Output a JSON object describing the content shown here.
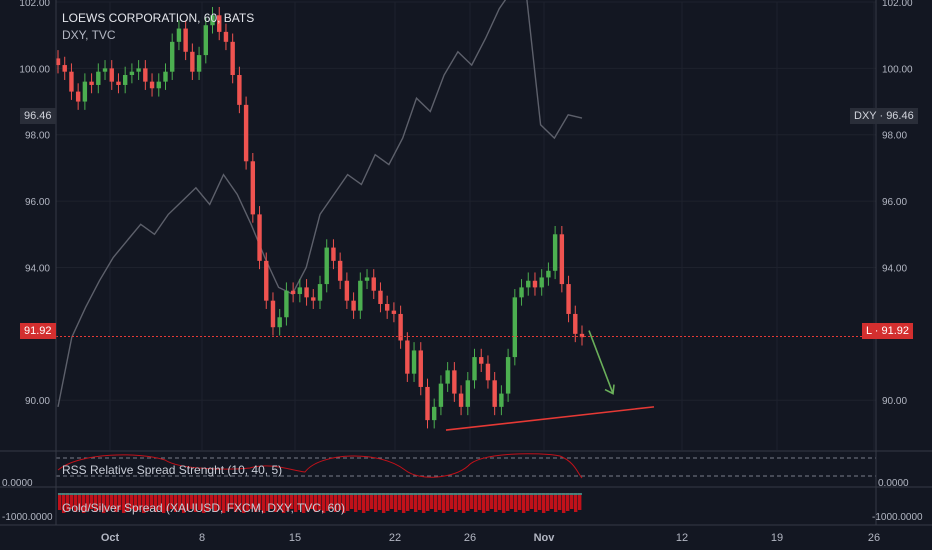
{
  "header": {
    "symbol_line": "LOEWS CORPORATION, 60, BATS",
    "overlay_line": "DXY, TVC"
  },
  "price_scale": {
    "ticks": [
      "102.00",
      "100.00",
      "98.00",
      "96.00",
      "94.00",
      "90.00"
    ],
    "current_price_label": "91.92",
    "right_current_label": "L · 91.92",
    "dxy_left_label": "96.46",
    "dxy_right_label": "DXY · 96.46"
  },
  "indicators": {
    "rss": {
      "label": "RSS Relative Spread Strenght (10, 40, 5)",
      "scale_label": "0.0000"
    },
    "gold_silver": {
      "label": "Gold/Silver Spread (XAUUSD, FXCM, DXY, TVC, 60)",
      "scale_label": "0.0000",
      "scale_label_low": "-1000.0000",
      "bar_color": "#c0111a"
    }
  },
  "time_axis": {
    "labels": [
      "Oct",
      "8",
      "15",
      "22",
      "26",
      "Nov",
      "12",
      "19",
      "26"
    ]
  },
  "colors": {
    "up_candle": "#4caf50",
    "down_candle": "#ef5350",
    "dxy_line": "#5d606b",
    "price_line": "#e53935",
    "support_line": "#e53935",
    "arrow": "#6aaf5a"
  },
  "chart_data": {
    "type": "candlestick",
    "series": [
      {
        "name": "LOEWS CORPORATION, 60, BATS",
        "ohlc_close": [
          100.1,
          99.9,
          99.3,
          99.0,
          99.6,
          99.5,
          99.9,
          100.0,
          99.6,
          99.5,
          99.8,
          99.9,
          100.0,
          99.6,
          99.4,
          99.6,
          99.9,
          100.8,
          101.2,
          100.5,
          99.9,
          100.4,
          101.3,
          101.6,
          101.1,
          100.8,
          99.8,
          98.9,
          97.2,
          95.6,
          94.2,
          93.0,
          92.2,
          92.5,
          93.3,
          93.2,
          93.4,
          93.1,
          93.0,
          93.5,
          94.6,
          94.2,
          93.6,
          93.0,
          92.7,
          93.6,
          93.7,
          93.3,
          92.9,
          92.7,
          92.6,
          91.8,
          90.8,
          91.5,
          90.4,
          89.4,
          89.8,
          90.5,
          90.9,
          90.2,
          89.8,
          90.6,
          91.3,
          91.1,
          90.6,
          89.8,
          90.2,
          91.3,
          93.1,
          93.4,
          93.6,
          93.4,
          93.7,
          93.9,
          95.0,
          93.5,
          92.6,
          92.0,
          91.9
        ],
        "range": [
          "Oct 1",
          "Nov 5"
        ]
      },
      {
        "name": "DXY, TVC",
        "values": [
          89.8,
          91.9,
          92.8,
          93.6,
          94.3,
          94.8,
          95.3,
          95.0,
          95.6,
          96.0,
          96.4,
          95.9,
          96.8,
          96.2,
          95.3,
          94.3,
          93.4,
          93.2,
          94.0,
          95.6,
          96.2,
          96.8,
          96.5,
          97.4,
          97.1,
          97.9,
          99.1,
          98.7,
          99.8,
          100.5,
          100.1,
          100.9,
          101.8,
          102.4,
          102.1,
          98.3,
          97.9,
          98.6,
          98.5
        ],
        "range": [
          "Oct 1",
          "Nov 4"
        ]
      }
    ],
    "current_price": 91.92,
    "ylim": [
      88.5,
      102.0
    ],
    "y_ticks": [
      102.0,
      100.0,
      98.0,
      96.0,
      94.0,
      90.0
    ],
    "x_labels": [
      "Oct",
      "8",
      "15",
      "22",
      "26",
      "Nov",
      "12",
      "19",
      "26"
    ],
    "annotations": {
      "support_line": {
        "from": [
          "Oct 24",
          89.1
        ],
        "to": [
          "Nov 14",
          89.8
        ]
      },
      "arrow_down": {
        "from": [
          "Nov 4",
          92.1
        ],
        "to": [
          "Nov 6",
          90.2
        ]
      }
    },
    "grid": true
  }
}
